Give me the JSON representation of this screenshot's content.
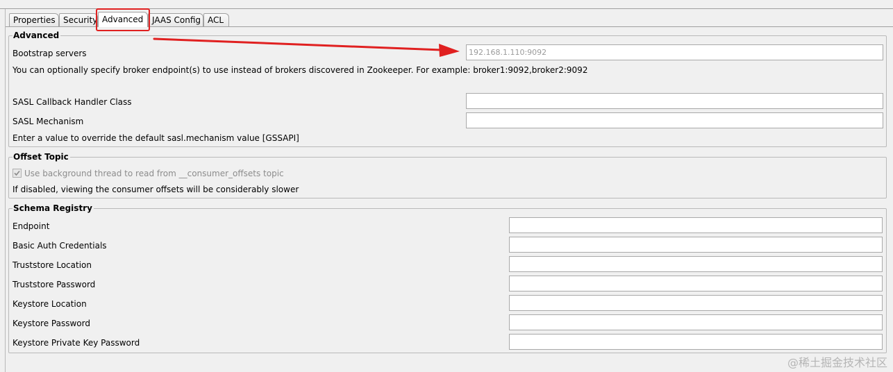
{
  "tabs": [
    {
      "label": "Properties"
    },
    {
      "label": "Security"
    },
    {
      "label": "Advanced"
    },
    {
      "label": "JAAS Config"
    },
    {
      "label": "ACL"
    }
  ],
  "active_tab": "Advanced",
  "advanced": {
    "title": "Advanced",
    "bootstrap_label": "Bootstrap servers",
    "bootstrap_value": "192.168.1.110:9092",
    "bootstrap_hint": "You can optionally specify broker endpoint(s) to use instead of brokers discovered in Zookeeper. For example: broker1:9092,broker2:9092",
    "sasl_callback_label": "SASL Callback Handler Class",
    "sasl_callback_value": "",
    "sasl_mechanism_label": "SASL Mechanism",
    "sasl_mechanism_value": "",
    "sasl_mechanism_hint": "Enter a value to override the default sasl.mechanism value [GSSAPI]"
  },
  "offset_topic": {
    "title": "Offset Topic",
    "checkbox_label": "Use background thread to read from __consumer_offsets topic",
    "checked": true,
    "hint": "If disabled, viewing the consumer offsets will be considerably slower"
  },
  "schema_registry": {
    "title": "Schema Registry",
    "fields": [
      {
        "label": "Endpoint",
        "value": ""
      },
      {
        "label": "Basic Auth Credentials",
        "value": ""
      },
      {
        "label": "Truststore Location",
        "value": ""
      },
      {
        "label": "Truststore Password",
        "value": ""
      },
      {
        "label": "Keystore Location",
        "value": ""
      },
      {
        "label": "Keystore Password",
        "value": ""
      },
      {
        "label": "Keystore Private Key Password",
        "value": ""
      }
    ]
  },
  "annotation": {
    "highlight_color": "#e02020"
  },
  "watermark": "@稀土掘金技术社区"
}
